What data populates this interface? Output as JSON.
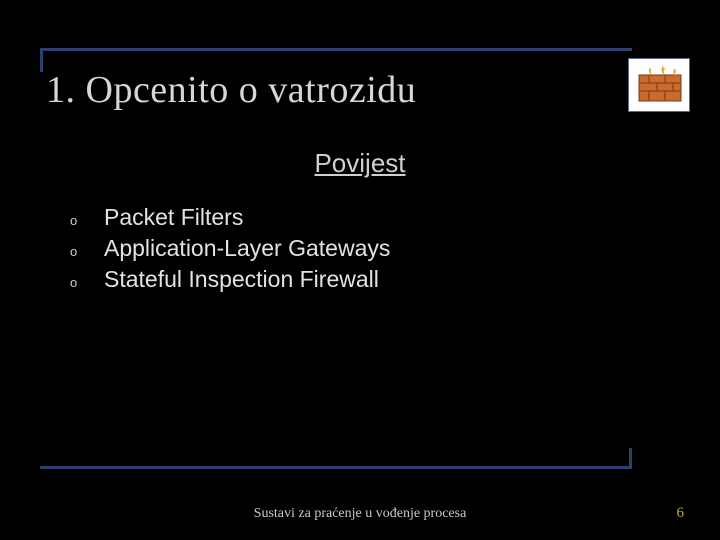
{
  "title": "1. Opcenito o vatrozidu",
  "subtitle": "Povijest",
  "bullets": [
    "Packet Filters",
    "Application-Layer Gateways",
    "Stateful Inspection Firewall"
  ],
  "icon": {
    "name": "firewall-icon"
  },
  "footer": "Sustavi za praćenje u vođenje procesa",
  "page_number": "6"
}
